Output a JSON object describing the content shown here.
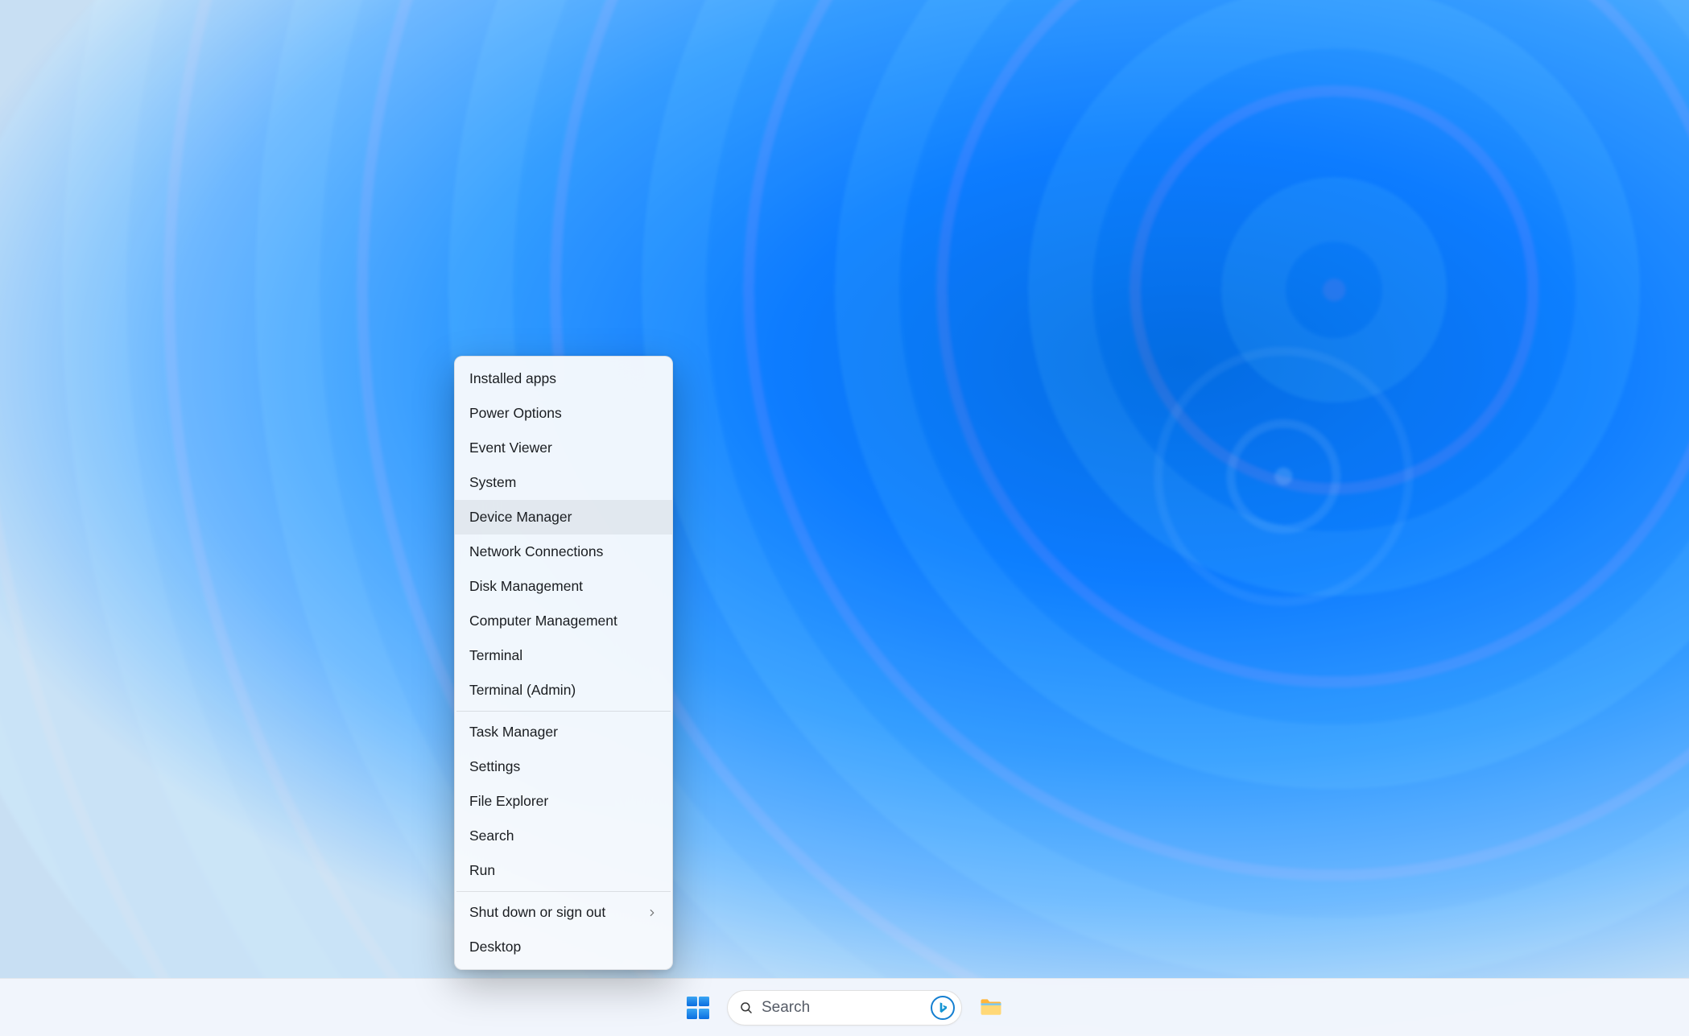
{
  "winx_menu": {
    "groups": [
      [
        {
          "id": "installed-apps",
          "label": "Installed apps",
          "submenu": false,
          "hovered": false
        },
        {
          "id": "power-options",
          "label": "Power Options",
          "submenu": false,
          "hovered": false
        },
        {
          "id": "event-viewer",
          "label": "Event Viewer",
          "submenu": false,
          "hovered": false
        },
        {
          "id": "system",
          "label": "System",
          "submenu": false,
          "hovered": false
        },
        {
          "id": "device-manager",
          "label": "Device Manager",
          "submenu": false,
          "hovered": true
        },
        {
          "id": "network-connections",
          "label": "Network Connections",
          "submenu": false,
          "hovered": false
        },
        {
          "id": "disk-management",
          "label": "Disk Management",
          "submenu": false,
          "hovered": false
        },
        {
          "id": "computer-management",
          "label": "Computer Management",
          "submenu": false,
          "hovered": false
        },
        {
          "id": "terminal",
          "label": "Terminal",
          "submenu": false,
          "hovered": false
        },
        {
          "id": "terminal-admin",
          "label": "Terminal (Admin)",
          "submenu": false,
          "hovered": false
        }
      ],
      [
        {
          "id": "task-manager",
          "label": "Task Manager",
          "submenu": false,
          "hovered": false
        },
        {
          "id": "settings",
          "label": "Settings",
          "submenu": false,
          "hovered": false
        },
        {
          "id": "file-explorer",
          "label": "File Explorer",
          "submenu": false,
          "hovered": false
        },
        {
          "id": "search",
          "label": "Search",
          "submenu": false,
          "hovered": false
        },
        {
          "id": "run",
          "label": "Run",
          "submenu": false,
          "hovered": false
        }
      ],
      [
        {
          "id": "shut-down-or-sign-out",
          "label": "Shut down or sign out",
          "submenu": true,
          "hovered": false
        },
        {
          "id": "desktop",
          "label": "Desktop",
          "submenu": false,
          "hovered": false
        }
      ]
    ]
  },
  "taskbar": {
    "start_tooltip": "Start",
    "search_placeholder": "Search",
    "search_provider_icon": "bing-icon",
    "pinned": [
      {
        "id": "file-explorer",
        "icon": "file-explorer-icon",
        "tooltip": "File Explorer"
      }
    ]
  },
  "colors": {
    "accent": "#0a6de0",
    "menu_bg": "rgba(248,250,253,0.96)",
    "taskbar_bg": "rgba(243,246,252,0.96)"
  }
}
